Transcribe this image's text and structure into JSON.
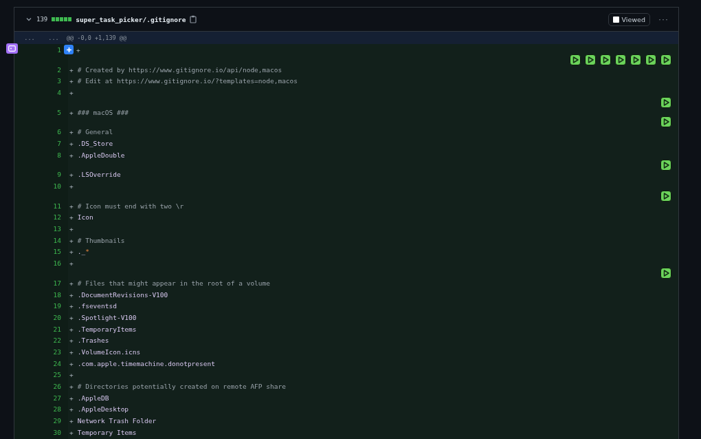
{
  "file_header": {
    "expanded": true,
    "changes": "139",
    "diffstat": [
      {
        "added": true
      },
      {
        "added": true
      },
      {
        "added": true
      },
      {
        "added": true
      },
      {
        "added": true
      }
    ],
    "path": "super_task_picker/.gitignore",
    "viewed": false,
    "viewed_label": "Viewed",
    "menu": "···"
  },
  "hunk": {
    "old_marker": "...",
    "new_marker": "...",
    "header": "@@ -0,0 +1,139 @@"
  },
  "lines": [
    {
      "number": "1",
      "marker": "+",
      "comment_button": true,
      "play_buttons": [
        {
          "kind": "play"
        },
        {
          "kind": "play"
        },
        {
          "kind": "play"
        },
        {
          "kind": "play"
        },
        {
          "kind": "play"
        },
        {
          "kind": "play"
        },
        {
          "kind": "play"
        }
      ]
    },
    {
      "number": "2",
      "marker": "+",
      "text": "# Created by https://www.gitignore.io/api/node,macos",
      "kind": "comment"
    },
    {
      "number": "3",
      "marker": "+",
      "text": "# Edit at https://www.gitignore.io/?templates=node,macos",
      "kind": "comment"
    },
    {
      "number": "4",
      "marker": "+",
      "play_buttons": [
        {
          "kind": "play"
        }
      ]
    },
    {
      "number": "5",
      "marker": "+",
      "text": "### macOS ###",
      "kind": "comment",
      "play_buttons": [
        {
          "kind": "play"
        }
      ]
    },
    {
      "number": "6",
      "marker": "+",
      "text": "# General",
      "kind": "comment"
    },
    {
      "number": "7",
      "marker": "+",
      "text": ".DS_Store",
      "kind": "entry"
    },
    {
      "number": "8",
      "marker": "+",
      "text": ".AppleDouble",
      "kind": "entry",
      "play_buttons": [
        {
          "kind": "play"
        }
      ]
    },
    {
      "number": "9",
      "marker": "+",
      "text": ".LSOverride",
      "kind": "entry"
    },
    {
      "number": "10",
      "marker": "+",
      "play_buttons": [
        {
          "kind": "play"
        }
      ]
    },
    {
      "number": "11",
      "marker": "+",
      "text": "# Icon must end with two \\r",
      "kind": "comment"
    },
    {
      "number": "12",
      "marker": "+",
      "text": "Icon",
      "kind": "entry"
    },
    {
      "number": "13",
      "marker": "+"
    },
    {
      "number": "14",
      "marker": "+",
      "text": "# Thumbnails",
      "kind": "comment"
    },
    {
      "number": "15",
      "marker": "+",
      "text": "._",
      "accent": "*",
      "kind": "entry"
    },
    {
      "number": "16",
      "marker": "+",
      "play_buttons": [
        {
          "kind": "play"
        }
      ]
    },
    {
      "number": "17",
      "marker": "+",
      "text": "# Files that might appear in the root of a volume",
      "kind": "comment"
    },
    {
      "number": "18",
      "marker": "+",
      "text": ".DocumentRevisions-V100",
      "kind": "entry"
    },
    {
      "number": "19",
      "marker": "+",
      "text": ".fseventsd",
      "kind": "entry"
    },
    {
      "number": "20",
      "marker": "+",
      "text": ".Spotlight-V100",
      "kind": "entry"
    },
    {
      "number": "21",
      "marker": "+",
      "text": ".TemporaryItems",
      "kind": "entry"
    },
    {
      "number": "22",
      "marker": "+",
      "text": ".Trashes",
      "kind": "entry"
    },
    {
      "number": "23",
      "marker": "+",
      "text": ".VolumeIcon.icns",
      "kind": "entry"
    },
    {
      "number": "24",
      "marker": "+",
      "text": ".com.apple.timemachine.donotpresent",
      "kind": "entry"
    },
    {
      "number": "25",
      "marker": "+"
    },
    {
      "number": "26",
      "marker": "+",
      "text": "# Directories potentially created on remote AFP share",
      "kind": "comment"
    },
    {
      "number": "27",
      "marker": "+",
      "text": ".AppleDB",
      "kind": "entry"
    },
    {
      "number": "28",
      "marker": "+",
      "text": ".AppleDesktop",
      "kind": "entry"
    },
    {
      "number": "29",
      "marker": "+",
      "text": "Network Trash Folder",
      "kind": "entry"
    },
    {
      "number": "30",
      "marker": "+",
      "text": "Temporary Items",
      "kind": "entry"
    }
  ]
}
